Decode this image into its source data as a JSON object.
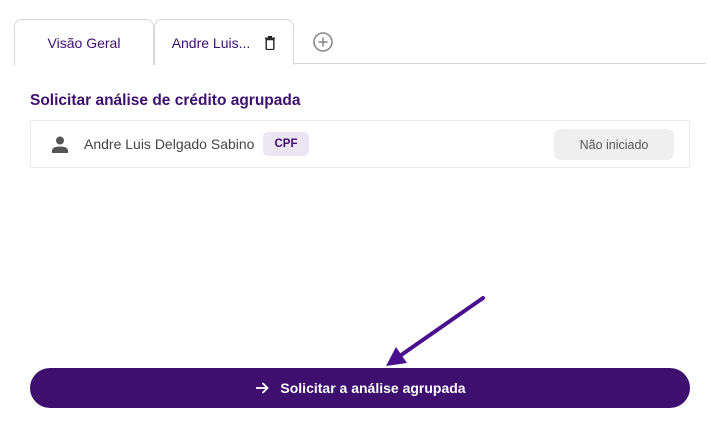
{
  "tabs": [
    {
      "label": "Visão Geral"
    },
    {
      "label": "Andre Luis..."
    }
  ],
  "section": {
    "title": "Solicitar análise de crédito agrupada"
  },
  "people": [
    {
      "name": "Andre Luis Delgado Sabino",
      "document_type": "CPF",
      "status": "Não iniciado"
    }
  ],
  "actions": {
    "submit_label": "Solicitar a análise agrupada"
  },
  "icons": {
    "tab_delete": "trash-icon",
    "add_tab": "plus-circle-icon",
    "person": "person-icon",
    "submit": "arrow-right-icon",
    "annotation": "annotation-arrow"
  },
  "colors": {
    "brand": "#3d0f6e",
    "badge_bg": "#ece6f4",
    "status_bg": "#efefef",
    "annotation_arrow": "#4a0f8f"
  }
}
